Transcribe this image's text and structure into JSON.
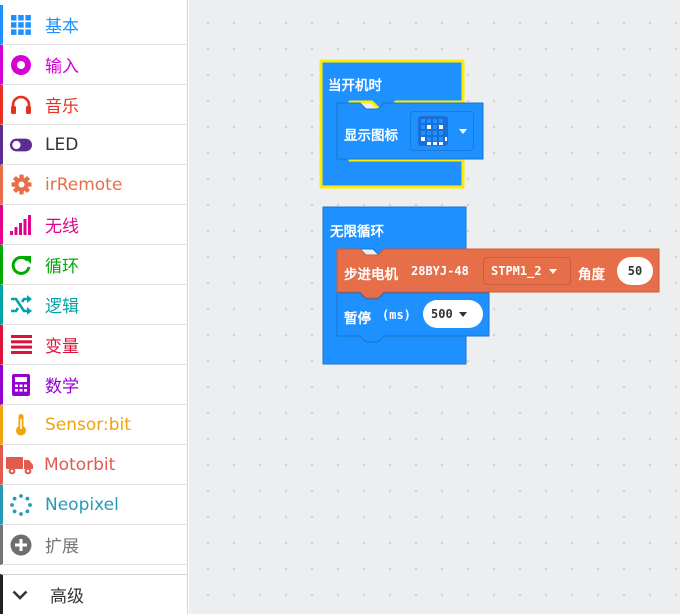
{
  "toolbox": {
    "categories": [
      {
        "label": "基本",
        "color": "#1e90ff",
        "icon": "grid-icon"
      },
      {
        "label": "输入",
        "color": "#d400d4",
        "icon": "radio-button-icon"
      },
      {
        "label": "音乐",
        "color": "#e63022",
        "icon": "headphones-icon"
      },
      {
        "label": "LED",
        "color": "#5c2d91",
        "icon": "toggle-icon"
      },
      {
        "label": "irRemote",
        "color": "#e66f4a",
        "icon": "gear-icon"
      },
      {
        "label": "无线",
        "color": "#e3008c",
        "icon": "signal-bars-icon"
      },
      {
        "label": "循环",
        "color": "#00aa00",
        "icon": "refresh-icon"
      },
      {
        "label": "逻辑",
        "color": "#00a4a6",
        "icon": "shuffle-icon"
      },
      {
        "label": "变量",
        "color": "#dc143c",
        "icon": "list-icon"
      },
      {
        "label": "数学",
        "color": "#9400d3",
        "icon": "calculator-icon"
      },
      {
        "label": "Sensor:bit",
        "color": "#f0a30a",
        "icon": "thermometer-icon"
      },
      {
        "label": "Motorbit",
        "color": "#e05a4e",
        "icon": "truck-icon"
      },
      {
        "label": "Neopixel",
        "color": "#2699b5",
        "icon": "dotted-ring-icon"
      },
      {
        "label": "扩展",
        "color": "#757575",
        "icon": "plus-circle-icon"
      }
    ],
    "advanced": {
      "label": "高级",
      "icon": "chevron-down-icon"
    }
  },
  "workspace": {
    "on_start": {
      "label": "当开机时",
      "color": "#1e90ff",
      "highlight": "#ffee00"
    },
    "show_icon": {
      "label": "显示图标"
    },
    "forever": {
      "label": "无限循环"
    },
    "stepper": {
      "label": "步进电机",
      "model": "28BYJ-48",
      "port": "STPM1_2",
      "angle_label": "角度",
      "angle_value": "50",
      "color": "#e66f4a"
    },
    "pause": {
      "label": "暂停",
      "unit": "(ms)",
      "value": "500"
    }
  }
}
